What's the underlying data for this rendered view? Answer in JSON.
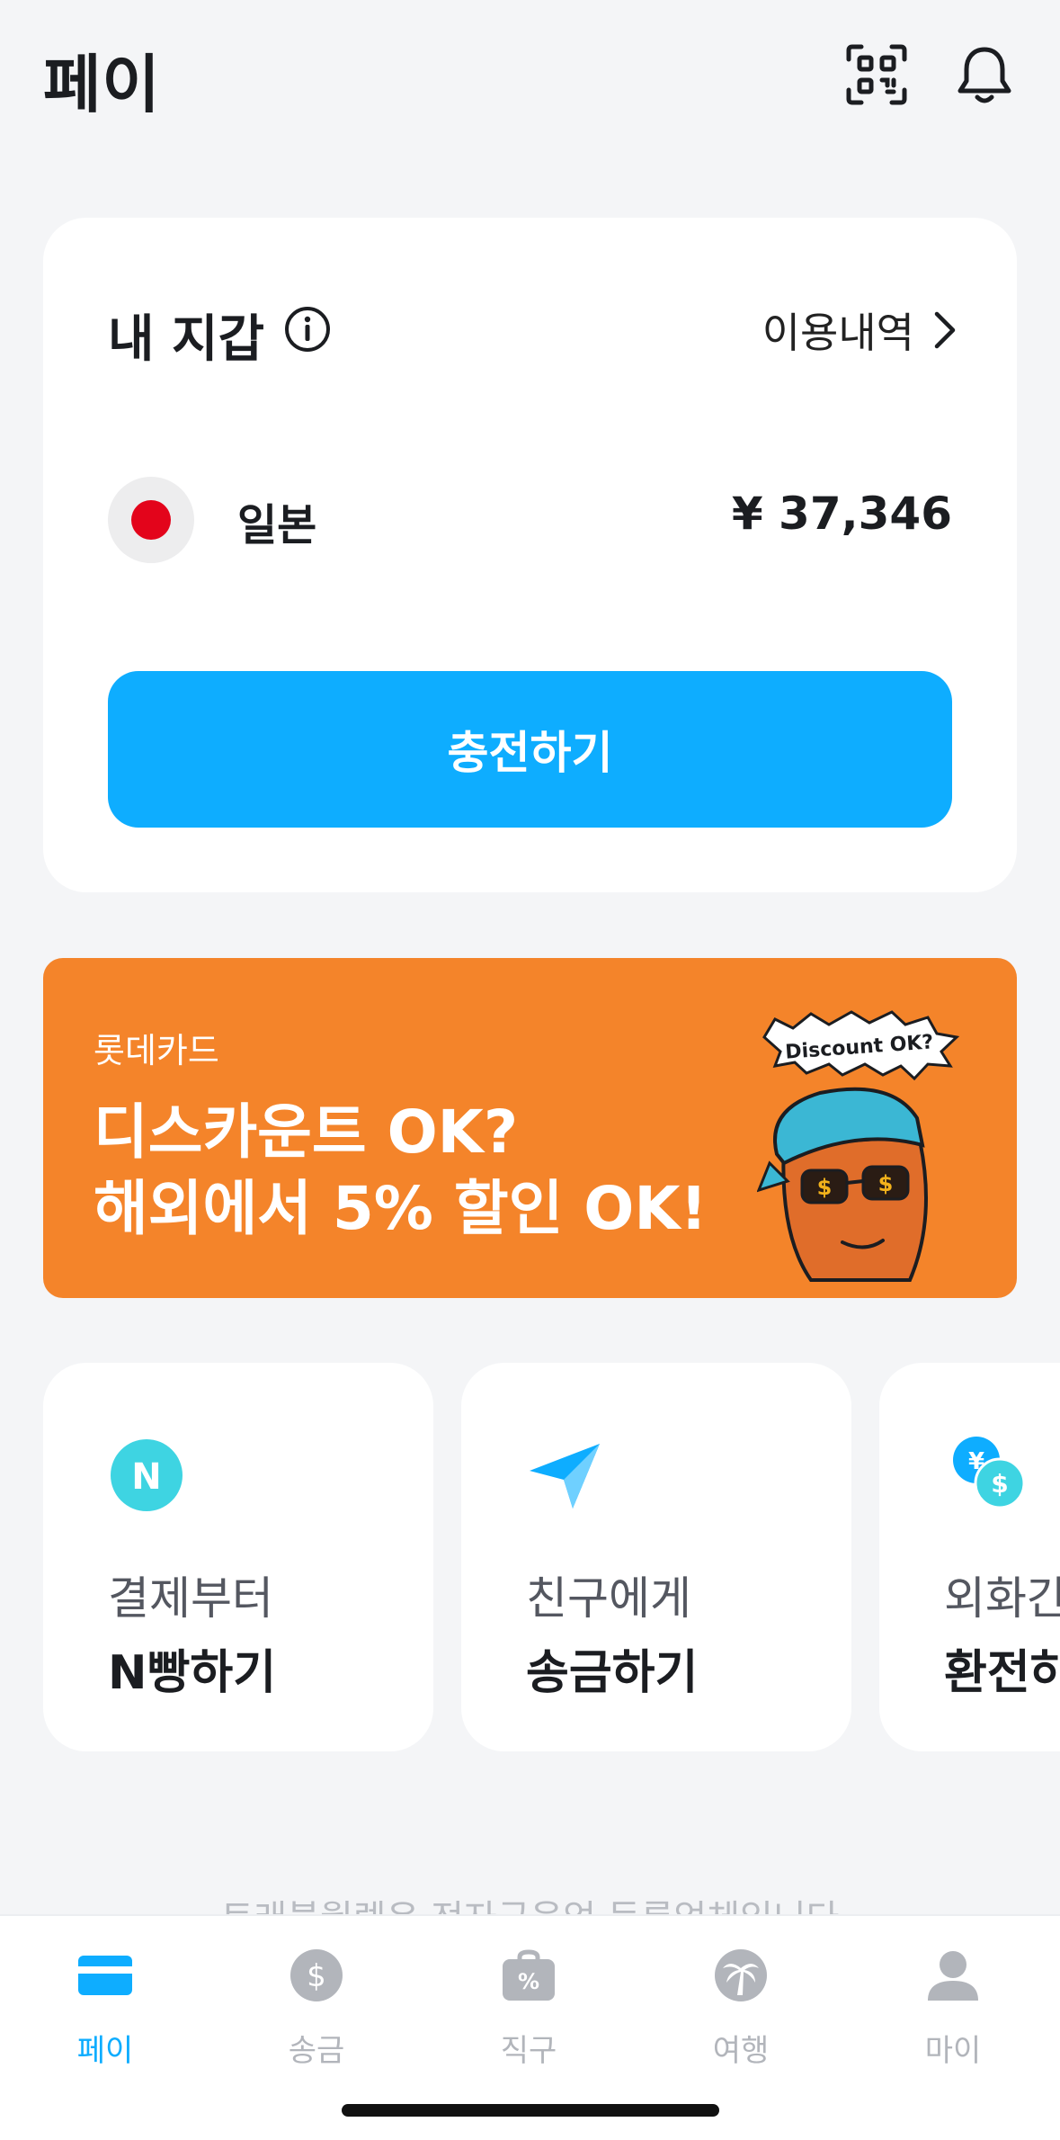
{
  "header": {
    "title": "페이",
    "qr_icon": "qr-scan-icon",
    "bell_icon": "bell-icon"
  },
  "wallet": {
    "title": "내 지갑",
    "history_label": "이용내역",
    "country": "일본",
    "balance": "¥ 37,346",
    "charge_label": "충전하기"
  },
  "banner": {
    "brand": "롯데카드",
    "line1": "디스카운트 OK?",
    "line2": "해외에서 5% 할인 OK!",
    "speech": "Discount OK?",
    "color": "#f4842a"
  },
  "quick_actions": [
    {
      "sub": "결제부터",
      "main": "N빵하기",
      "icon": "n-split-icon"
    },
    {
      "sub": "친구에게",
      "main": "송금하기",
      "icon": "paper-plane-icon"
    },
    {
      "sub": "외화간",
      "main": "환전하",
      "icon": "currency-exchange-icon"
    }
  ],
  "footer_note": "트래블월렛은 전자금융업 등록업체입니다",
  "nav": [
    {
      "label": "페이",
      "icon": "card-icon",
      "active": true
    },
    {
      "label": "송금",
      "icon": "dollar-icon",
      "active": false
    },
    {
      "label": "직구",
      "icon": "shopping-bag-icon",
      "active": false
    },
    {
      "label": "여행",
      "icon": "palm-tree-icon",
      "active": false
    },
    {
      "label": "마이",
      "icon": "person-icon",
      "active": false
    }
  ],
  "colors": {
    "accent": "#0eadff",
    "flag_red": "#e3041b",
    "background": "#f4f5f7"
  }
}
